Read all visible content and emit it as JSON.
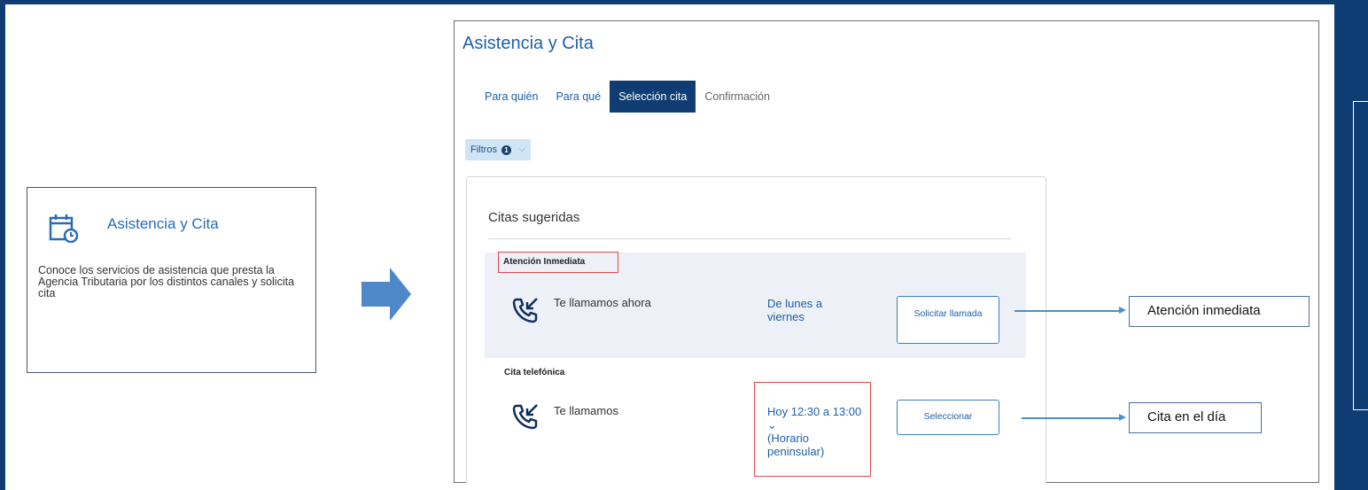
{
  "card": {
    "title": "Asistencia y Cita",
    "description": "Conoce los servicios de asistencia que presta la Agencia Tributaria por los distintos canales y solicita cita",
    "icon": "calendar-clock-icon"
  },
  "panel": {
    "title": "Asistencia y Cita",
    "tabs": [
      {
        "label": "Para quién"
      },
      {
        "label": "Para qué"
      },
      {
        "label": "Selección cita"
      },
      {
        "label": "Confirmación"
      }
    ],
    "filter_label": "Filtros",
    "filter_count": "1",
    "suggested_title": "Citas sugeridas",
    "immediate": {
      "section_title": "Atención Inmediata",
      "service_label": "Te llamamos ahora",
      "schedule": "De lunes a viernes",
      "button_label": "Solicitar llamada"
    },
    "phone_appt": {
      "section_title": "Cita telefónica",
      "service_label": "Te llamamos",
      "schedule": "Hoy 12:30 a 13:00",
      "schedule_chevron": "⌄",
      "schedule_note": "(Horario peninsular)",
      "button_label": "Seleccionar"
    }
  },
  "callouts": {
    "immediate": "Atención inmediata",
    "same_day": "Cita en el día"
  },
  "colors": {
    "background": "#0f3c72",
    "accent": "#1f5fa8",
    "highlight": "#e0474c"
  }
}
